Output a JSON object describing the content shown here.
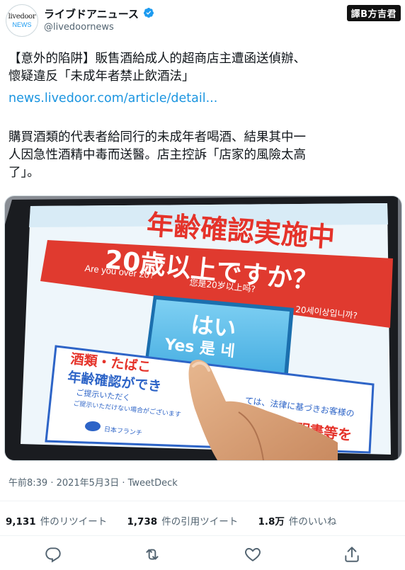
{
  "account": {
    "name": "ライブドアニュース",
    "handle": "@livedoornews",
    "avatar_line1": "livedoor",
    "avatar_line2": "NEWS",
    "verified_color": "#1d9bf0"
  },
  "watermark": "譯B方吉君",
  "tweet": {
    "line1": "【意外的陷阱】販售酒給成人的超商店主遭函送偵辦、",
    "line2": "懷疑違反「未成年者禁止飲酒法」",
    "link": "news.livedoor.com/article/detail...",
    "line4": "購買酒類的代表者給同行的未成年者喝酒、結果其中一",
    "line5": "人因急性酒精中毒而送醫。店主控訴「店家的風險太高",
    "line6": "了」。"
  },
  "photo": {
    "heading": "年齢確認実施中",
    "banner_main": "20歳以上ですか？",
    "banner_en": "Are you over 20?",
    "banner_cn": "您是20岁以上吗?",
    "banner_kr": "20세이상입니까?",
    "button_top": "はい",
    "button_bottom": "Yes  是  네",
    "notice_line1": "酒類・たばこ",
    "notice_line2": "年齢確認ができ",
    "notice_line3": "ご提示いただく",
    "notice_line4": "ご提示いただけない場合がございます",
    "notice_right": "ては、法律に基づきお客様の",
    "notice_right2": "明書等を",
    "logo_text": "日本フランチ"
  },
  "meta": "午前8:39 · 2021年5月3日 · TweetDeck",
  "stats": [
    {
      "count": "9,131",
      "label": "件のリツイート"
    },
    {
      "count": "1,738",
      "label": "件の引用ツイート"
    },
    {
      "count": "1.8万",
      "label": "件のいいね"
    }
  ],
  "actions": [
    "reply-icon",
    "retweet-icon",
    "like-icon",
    "share-icon"
  ]
}
